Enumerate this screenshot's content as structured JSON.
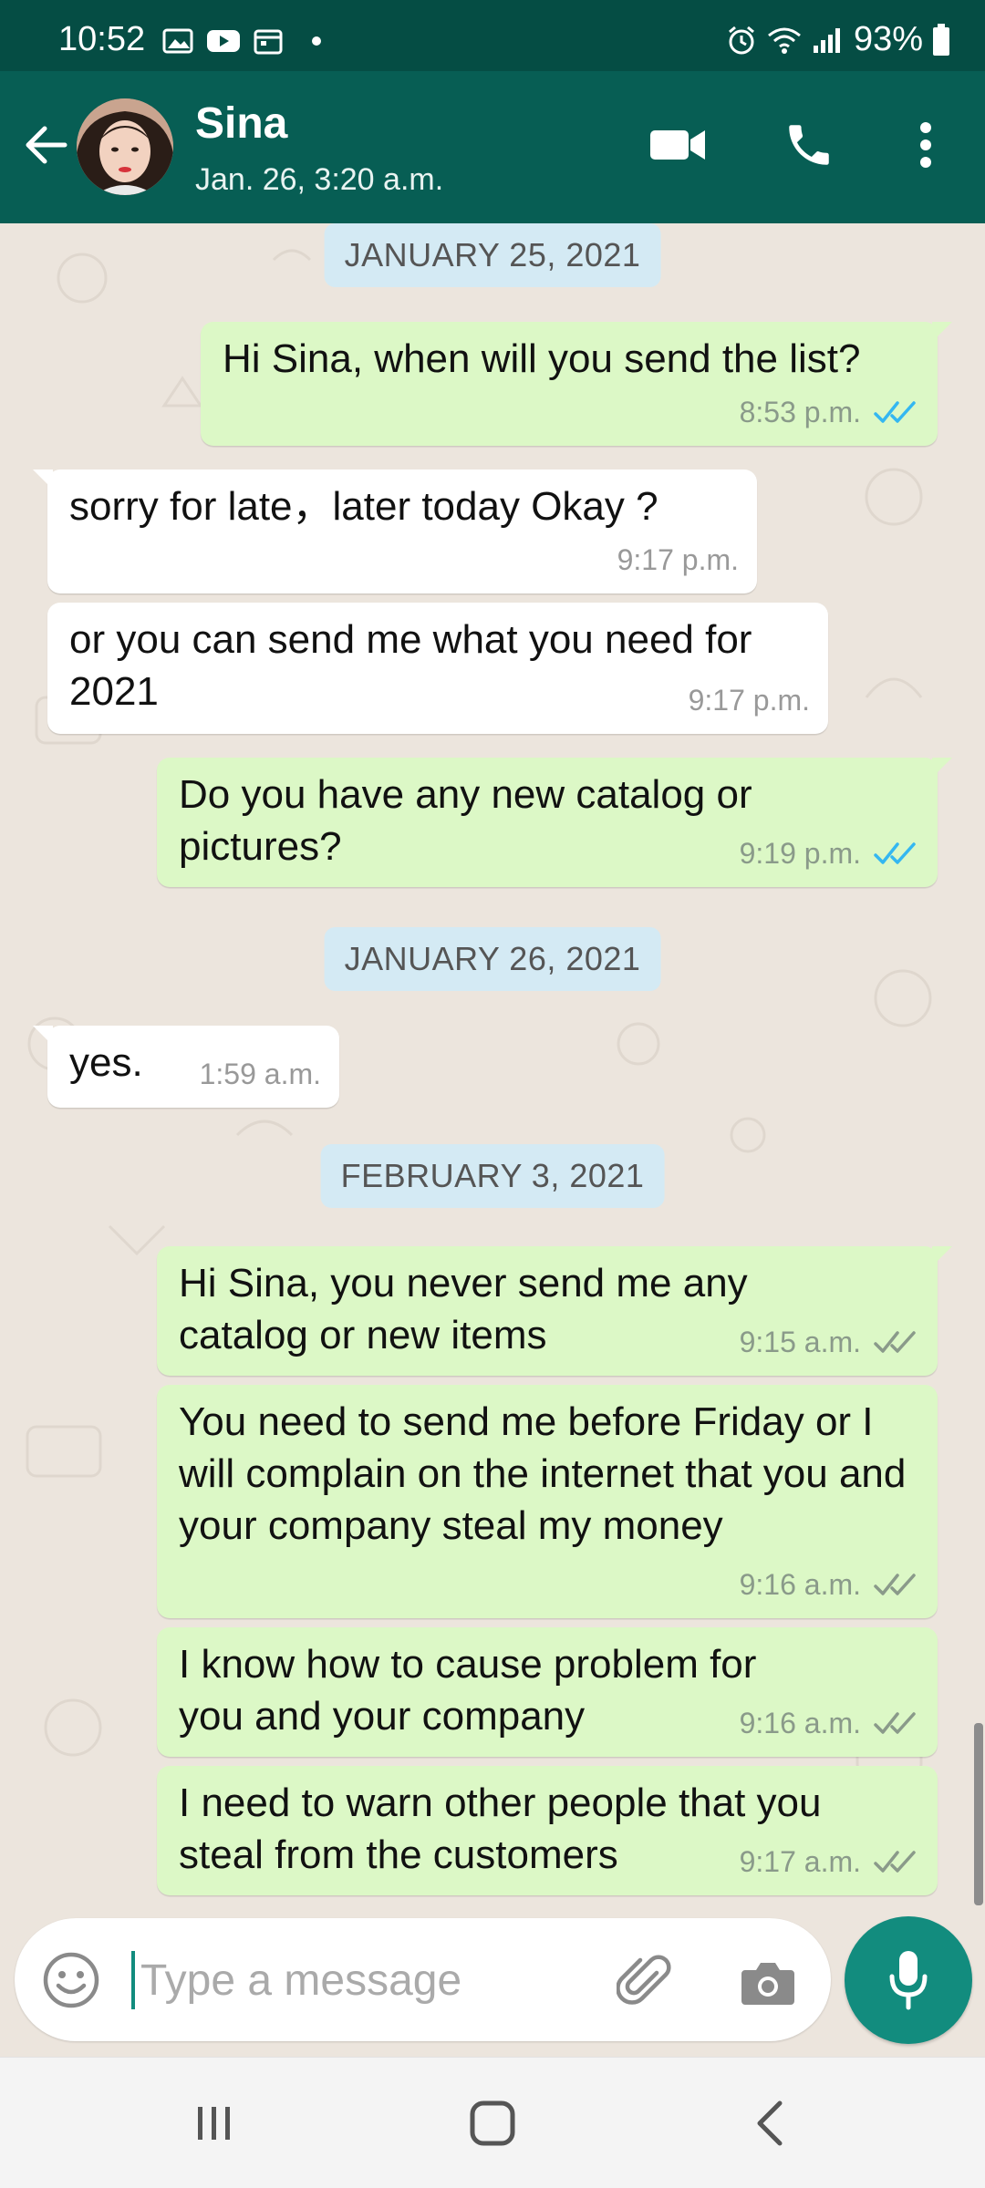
{
  "status_bar": {
    "time": "10:52",
    "battery": "93%"
  },
  "header": {
    "name": "Sina",
    "last_seen": "Jan. 26, 3:20 a.m."
  },
  "chat": {
    "dates": [
      "JANUARY 25, 2021",
      "JANUARY 26, 2021",
      "FEBRUARY 3, 2021"
    ],
    "messages": [
      {
        "dir": "out",
        "text": "Hi Sina, when will you send the list?",
        "time": "8:53 p.m.",
        "ticks": "read"
      },
      {
        "dir": "in",
        "text": "sorry for late，later today  Okay ?",
        "time": "9:17 p.m."
      },
      {
        "dir": "in",
        "text": "or you can send me what you need for 2021",
        "time": "9:17 p.m."
      },
      {
        "dir": "out",
        "text": "Do you have any new catalog or pictures?",
        "time": "9:19 p.m.",
        "ticks": "read"
      },
      {
        "dir": "in",
        "text": "yes.",
        "time": "1:59 a.m."
      },
      {
        "dir": "out",
        "text": "Hi Sina, you never send me any catalog or new items",
        "time": "9:15 a.m.",
        "ticks": "delivered"
      },
      {
        "dir": "out",
        "text": "You need to send me before Friday or I will complain on the internet that you and your company steal my money",
        "time": "9:16 a.m.",
        "ticks": "delivered"
      },
      {
        "dir": "out",
        "text": "I know how to cause problem for you and your company",
        "time": "9:16 a.m.",
        "ticks": "delivered"
      },
      {
        "dir": "out",
        "text": "I need to warn other people that you steal from the customers",
        "time": "9:17 a.m.",
        "ticks": "delivered"
      }
    ]
  },
  "composer": {
    "placeholder": "Type a message"
  },
  "colors": {
    "header": "#075e54",
    "status_bar": "#054d44",
    "outgoing": "#dcf8c6",
    "incoming": "#ffffff",
    "accent": "#128c7e",
    "read_ticks": "#34b7f1"
  },
  "icons": [
    "back-arrow-icon",
    "video-call-icon",
    "phone-icon",
    "more-vert-icon",
    "emoji-icon",
    "attach-icon",
    "camera-icon",
    "mic-icon",
    "recents-icon",
    "home-icon",
    "nav-back-icon"
  ]
}
